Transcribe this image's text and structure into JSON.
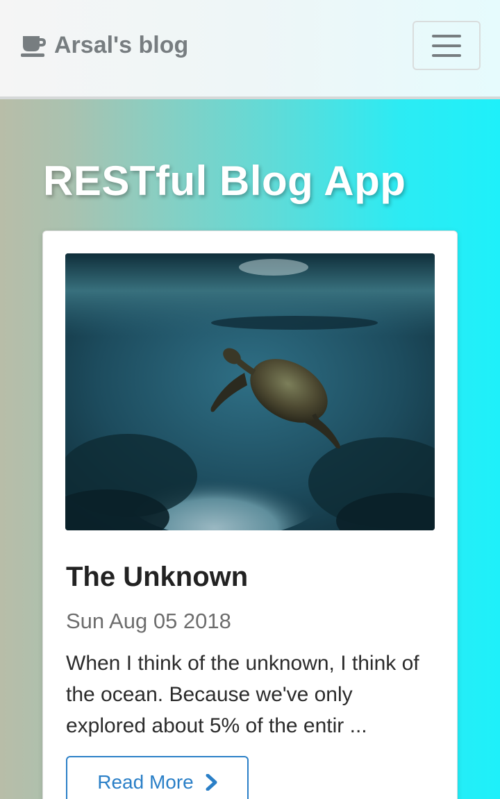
{
  "navbar": {
    "brand_label": "Arsal's blog",
    "brand_icon": "coffee-cup-icon",
    "menu_icon": "hamburger-menu-icon"
  },
  "page": {
    "title": "RESTful Blog App"
  },
  "post": {
    "image_icon": "sea-turtle-photo",
    "title": "The Unknown",
    "date": "Sun Aug 05 2018",
    "excerpt": "When I think of the unknown, I think of the ocean. Because we've only explored about 5% of the entir ...",
    "read_more_label": "Read More",
    "read_more_icon": "chevron-right-icon"
  },
  "colors": {
    "accent": "#2a7fc7",
    "brand_text": "#777d80",
    "gradient_start": "#b8bda8",
    "gradient_end": "#1ef0fa"
  }
}
